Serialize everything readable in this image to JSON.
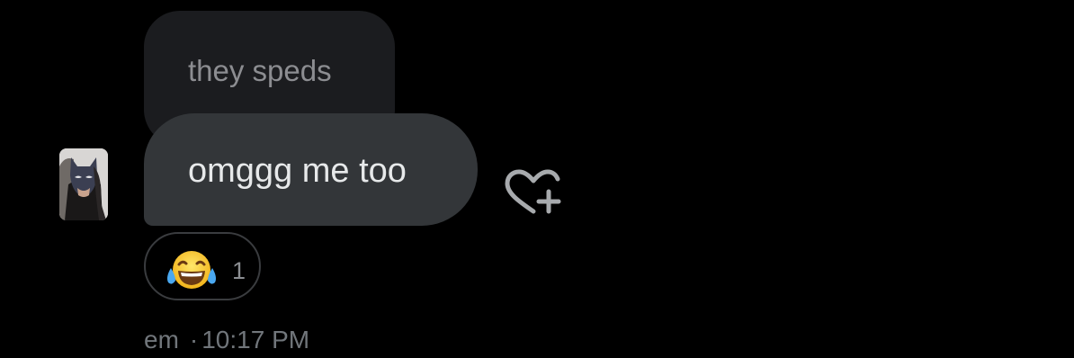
{
  "quoted_message": {
    "text": "they speds"
  },
  "message": {
    "text": "omggg me too"
  },
  "reactions": [
    {
      "emoji": "😂",
      "icon": "face-with-tears-of-joy-icon",
      "count": "1"
    }
  ],
  "meta": {
    "sender": "em",
    "separator": "·",
    "time": "10:17 PM"
  },
  "colors": {
    "background": "#000000",
    "quoted_bubble": "#1b1c1f",
    "message_bubble": "#333639",
    "message_text": "#e7e9ea",
    "muted_text": "#71767b"
  }
}
